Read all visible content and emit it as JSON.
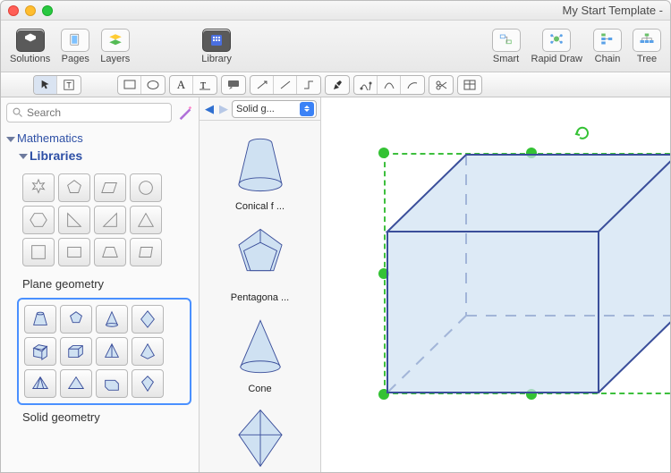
{
  "window": {
    "title": "My Start Template -"
  },
  "toolbar_main": {
    "solutions": "Solutions",
    "pages": "Pages",
    "layers": "Layers",
    "library": "Library",
    "smart": "Smart",
    "rapid_draw": "Rapid Draw",
    "chain": "Chain",
    "tree": "Tree"
  },
  "search": {
    "placeholder": "Search"
  },
  "tree": {
    "category": "Mathematics",
    "subcategory": "Libraries",
    "lib_plane": "Plane geometry",
    "lib_solid": "Solid geometry"
  },
  "panel": {
    "combo_label": "Solid g...",
    "items": [
      {
        "label": "Conical f ..."
      },
      {
        "label": "Pentagona ..."
      },
      {
        "label": "Cone"
      },
      {
        "label": ""
      }
    ]
  },
  "colors": {
    "shape_stroke": "#3a4e9a",
    "shape_fill": "#cfe1f2",
    "accent": "#3b82f6",
    "sel_green": "#34c234"
  }
}
